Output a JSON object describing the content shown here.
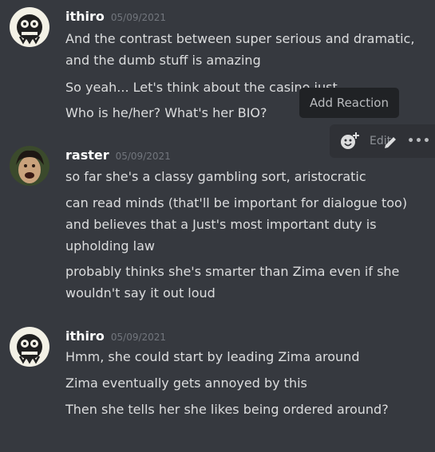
{
  "messages": [
    {
      "author": "ithiro",
      "timestamp": "05/09/2021",
      "lines": [
        "And the contrast between super serious and dramatic, and the dumb stuff is amazing",
        "So yeah... Let's think about the casino just",
        "Who is he/her? What's her BIO?"
      ]
    },
    {
      "author": "raster",
      "timestamp": "05/09/2021",
      "lines": [
        "so far she's a classy gambling sort, aristocratic",
        "can read minds (that'll be important for dialogue too) and believes that a Just's most important duty is upholding law",
        "probably thinks she's smarter than Zima even if she wouldn't say it out loud"
      ]
    },
    {
      "author": "ithiro",
      "timestamp": "05/09/2021",
      "lines": [
        "Hmm, she could start by leading Zima around",
        "Zima eventually gets annoyed by this",
        "Then she tells her she likes being ordered around?"
      ]
    }
  ],
  "toolbar": {
    "tooltip": "Add Reaction",
    "edit_label": "Edit",
    "more_label": "More",
    "icons": [
      "add-reaction-icon",
      "edit-icon",
      "more-icon"
    ]
  }
}
